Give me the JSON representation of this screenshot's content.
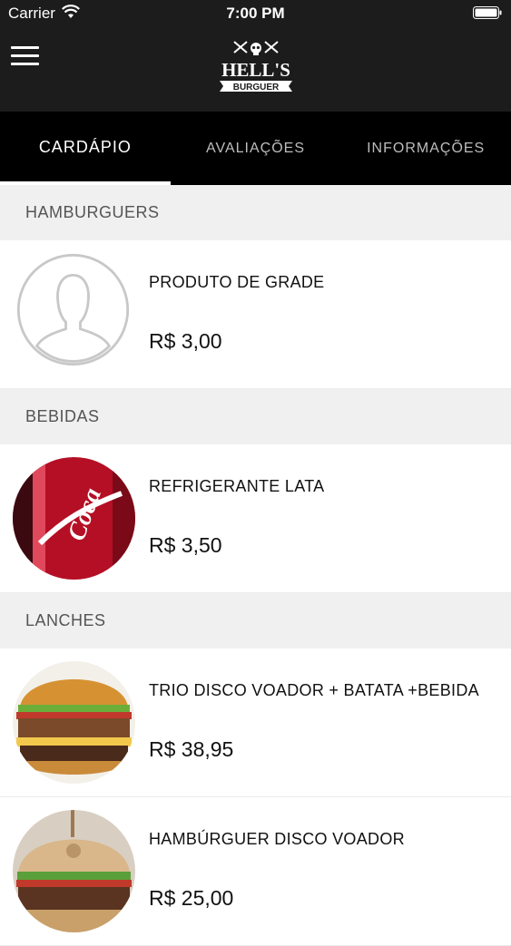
{
  "status_bar": {
    "carrier": "Carrier",
    "time": "7:00 PM"
  },
  "header": {
    "logo_line1": "HELL'S",
    "logo_line2": "BURGUER"
  },
  "tabs": [
    {
      "label": "CARDÁPIO",
      "active": true
    },
    {
      "label": "AVALIAÇÕES",
      "active": false
    },
    {
      "label": "INFORMAÇÕES",
      "active": false
    }
  ],
  "sections": [
    {
      "title": "HAMBURGUERS",
      "items": [
        {
          "name": "PRODUTO DE GRADE",
          "price": "R$ 3,00",
          "image": "user-placeholder-icon"
        }
      ]
    },
    {
      "title": "BEBIDAS",
      "items": [
        {
          "name": "REFRIGERANTE LATA",
          "price": "R$ 3,50",
          "image": "soda-can-photo"
        }
      ]
    },
    {
      "title": "LANCHES",
      "items": [
        {
          "name": "TRIO DISCO VOADOR + BATATA +BEBIDA",
          "price": "R$ 38,95",
          "image": "burger-photo"
        },
        {
          "name": "HAMBÚRGUER DISCO VOADOR",
          "price": "R$ 25,00",
          "image": "burger-photo"
        }
      ]
    }
  ],
  "colors": {
    "header_bg": "#1c1c1c",
    "tab_bg": "#000000",
    "section_bg": "#f0f0f0",
    "coke_red": "#c8102e"
  }
}
